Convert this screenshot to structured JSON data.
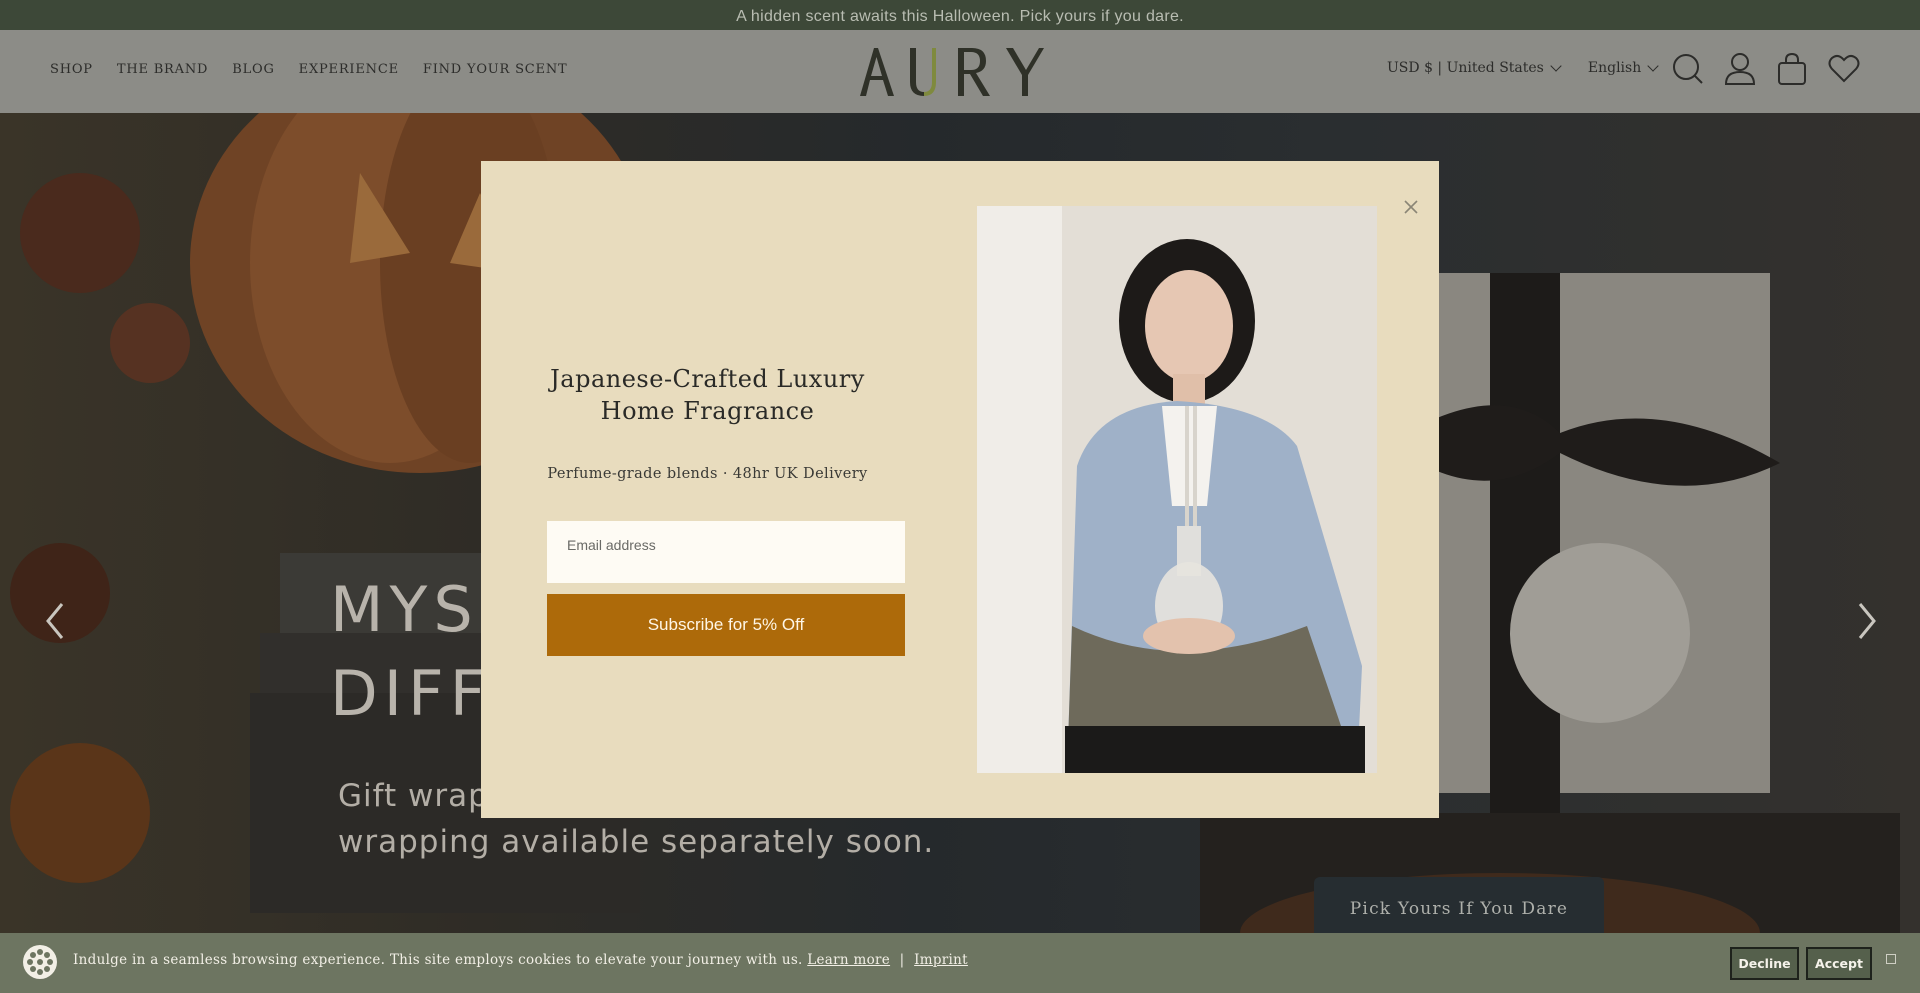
{
  "announcement": "A hidden scent awaits this Halloween. Pick yours if you dare.",
  "header": {
    "nav": [
      "SHOP",
      "THE BRAND",
      "BLOG",
      "EXPERIENCE",
      "FIND YOUR SCENT"
    ],
    "logo_text": "AURY",
    "currency": "USD $ | United States",
    "language": "English",
    "icons": [
      "search-icon",
      "account-icon",
      "cart-icon",
      "wishlist-icon"
    ]
  },
  "hero": {
    "title_line1": "MYS",
    "title_line2": "DIFF",
    "subtitle_line1": "Gift wrap",
    "subtitle_line2": "wrapping available separately soon.",
    "cta": "Pick Yours If You Dare",
    "prev_icon": "chevron-left-icon",
    "next_icon": "chevron-right-icon"
  },
  "modal": {
    "title": "Japanese-Crafted Luxury Home Fragrance",
    "subtitle": "Perfume-grade blends · 48hr UK Delivery",
    "email_placeholder": "Email address",
    "submit": "Subscribe for 5% Off",
    "close_icon": "close-icon"
  },
  "cookie": {
    "text": "Indulge in a seamless browsing experience. This site employs cookies to elevate your journey with us.",
    "learn_more": "Learn more",
    "separator": "|",
    "imprint": "Imprint",
    "decline": "Decline",
    "accept": "Accept"
  },
  "colors": {
    "announcement_bg": "#3d4838",
    "header_bg": "#8c8c87",
    "modal_bg": "#e8dcbe",
    "subscribe_bg": "#ad6a0a",
    "cookie_bg": "#6d7561"
  }
}
